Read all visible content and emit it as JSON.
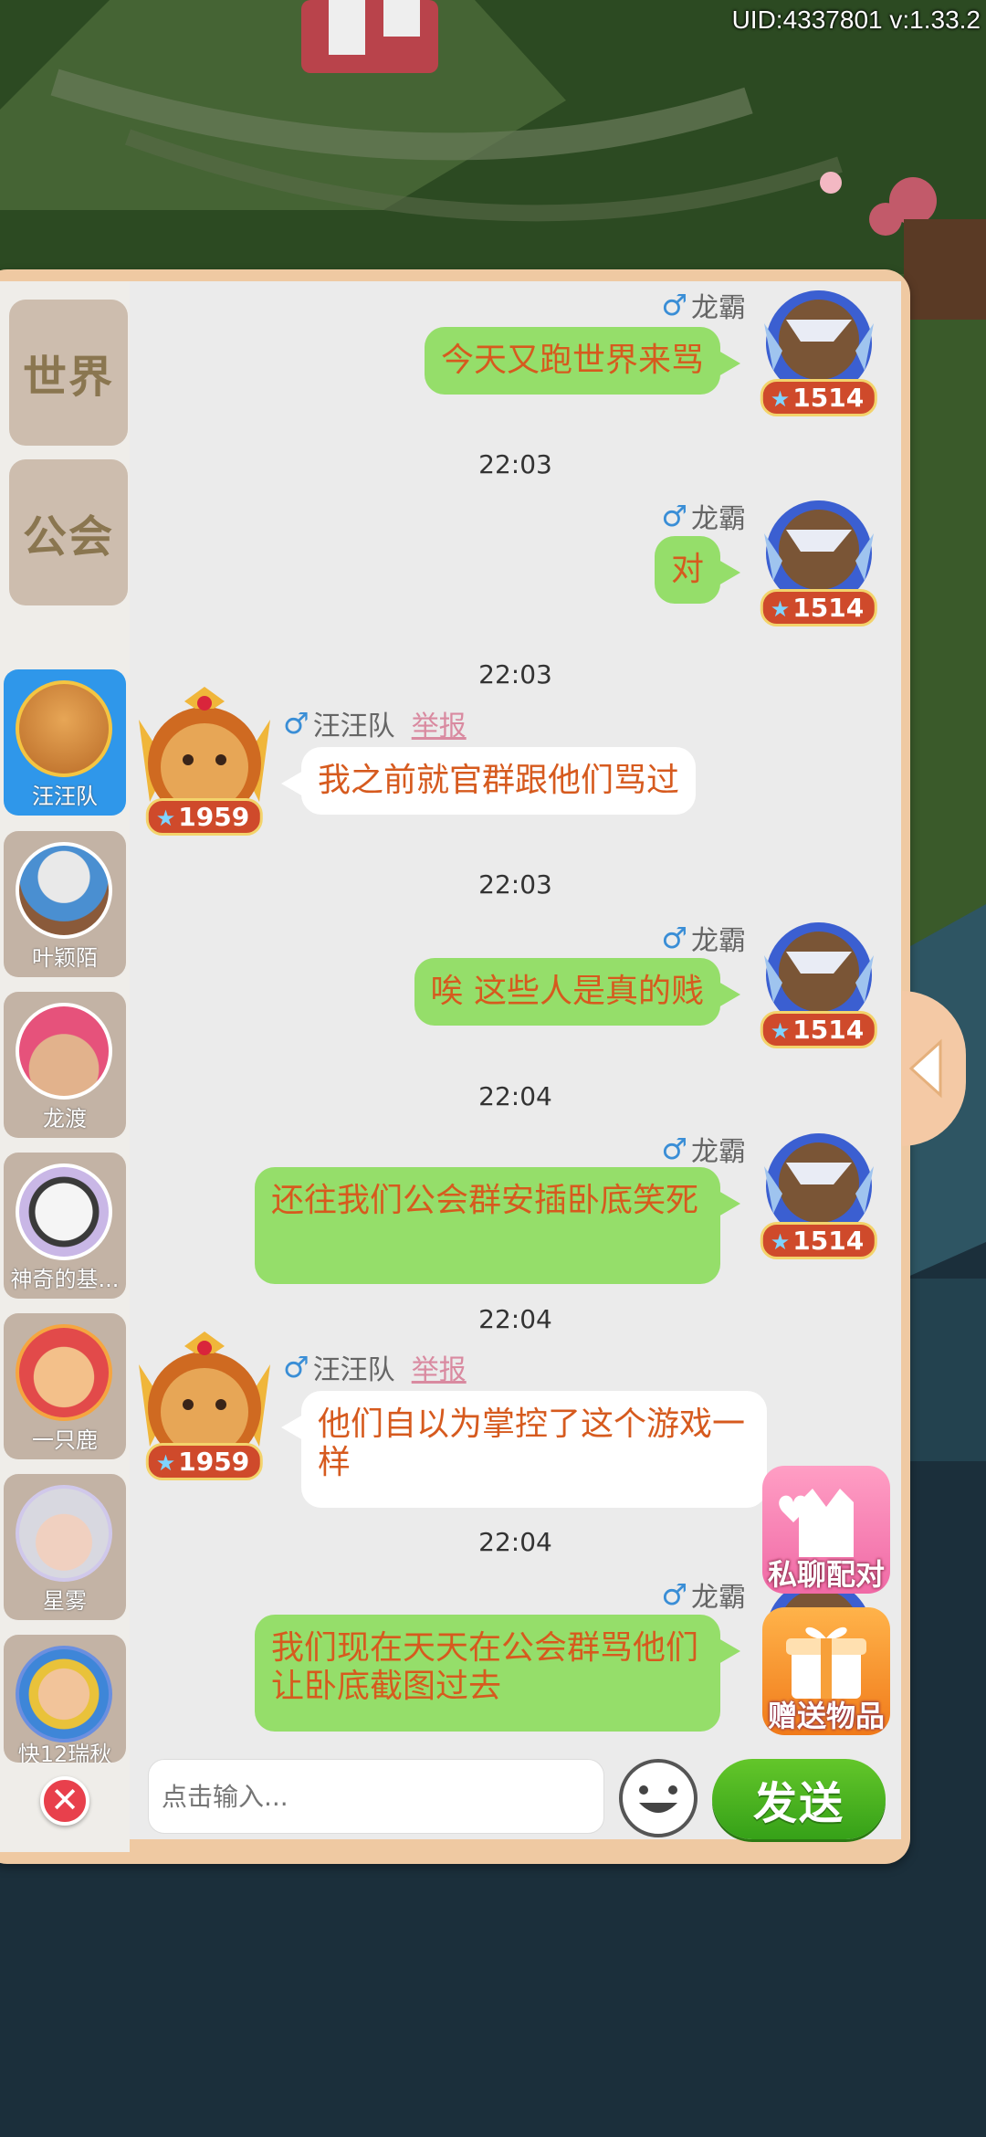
{
  "status": {
    "uid": "UID:4337801 v:1.33.2"
  },
  "tabs": [
    {
      "label": "世界"
    },
    {
      "label": "公会"
    }
  ],
  "contacts": [
    {
      "name": "汪汪队",
      "active": true
    },
    {
      "name": "叶颖陌"
    },
    {
      "name": "龙渡"
    },
    {
      "name": "神奇的基..."
    },
    {
      "name": "一只鹿"
    },
    {
      "name": "星雾"
    },
    {
      "name": "快12瑞秋"
    }
  ],
  "messages": [
    {
      "sender": "龙霸",
      "text": "今天又跑世界来骂",
      "level": "1514"
    },
    {
      "time": "22:03",
      "sender": "龙霸",
      "text": "对",
      "level": "1514"
    },
    {
      "time": "22:03",
      "sender": "汪汪队",
      "report": "举报",
      "text": "我之前就官群跟他们骂过",
      "level": "1959"
    },
    {
      "time": "22:03",
      "sender": "龙霸",
      "text": "唉 这些人是真的贱",
      "level": "1514"
    },
    {
      "time": "22:04",
      "sender": "龙霸",
      "text": "还往我们公会群安插卧底笑死",
      "level": "1514"
    },
    {
      "time": "22:04",
      "sender": "汪汪队",
      "report": "举报",
      "text": "他们自以为掌控了这个游戏一样",
      "level": "1959"
    },
    {
      "time": "22:04",
      "sender": "龙霸",
      "text": "我们现在天天在公会群骂他们 让卧底截图过去"
    }
  ],
  "input": {
    "placeholder": "点击输入..."
  },
  "send_label": "发送",
  "floating": {
    "private_match": "私聊配对",
    "gift": "赠送物品"
  },
  "icons": {
    "male": "male-icon",
    "close": "close-icon",
    "emoji": "smiley-icon",
    "collapse": "triangle-left-icon"
  }
}
